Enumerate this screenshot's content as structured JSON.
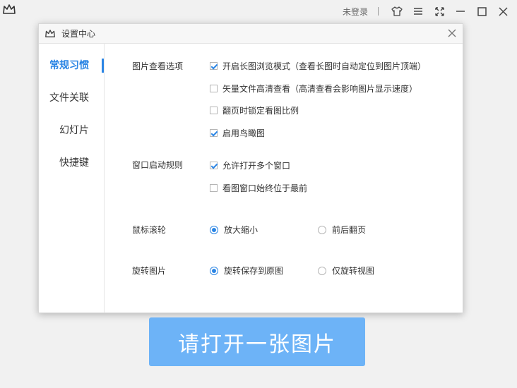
{
  "topbar": {
    "logo_icon": "crown-icon",
    "login_label": "未登录",
    "icons": [
      "skin-icon",
      "menu-icon",
      "fullscreen-icon",
      "minimize-icon",
      "maximize-icon",
      "close-icon"
    ]
  },
  "dialog": {
    "title": "设置中心",
    "close_icon": "close-icon"
  },
  "sidebar": {
    "items": [
      {
        "label": "常规习惯",
        "active": true
      },
      {
        "label": "文件关联",
        "active": false
      },
      {
        "label": "幻灯片",
        "active": false
      },
      {
        "label": "快捷键",
        "active": false
      }
    ]
  },
  "sections": {
    "view": {
      "label": "图片查看选项",
      "options": [
        {
          "label": "开启长图浏览模式（查看长图时自动定位到图片顶端）",
          "checked": true
        },
        {
          "label": "矢量文件高清查看（高清查看会影响图片显示速度）",
          "checked": false
        },
        {
          "label": "翻页时锁定看图比例",
          "checked": false
        },
        {
          "label": "启用鸟瞰图",
          "checked": true
        }
      ]
    },
    "window": {
      "label": "窗口启动规则",
      "options": [
        {
          "label": "允许打开多个窗口",
          "checked": true
        },
        {
          "label": "看图窗口始终位于最前",
          "checked": false
        }
      ]
    },
    "wheel": {
      "label": "鼠标滚轮",
      "options": [
        {
          "label": "放大缩小",
          "selected": true
        },
        {
          "label": "前后翻页",
          "selected": false
        }
      ]
    },
    "rotate": {
      "label": "旋转图片",
      "options": [
        {
          "label": "旋转保存到原图",
          "selected": true
        },
        {
          "label": "仅旋转视图",
          "selected": false
        }
      ]
    }
  },
  "main": {
    "open_button_label": "请打开一张图片"
  },
  "colors": {
    "accent": "#2b85e4",
    "button": "#6db3f7"
  }
}
